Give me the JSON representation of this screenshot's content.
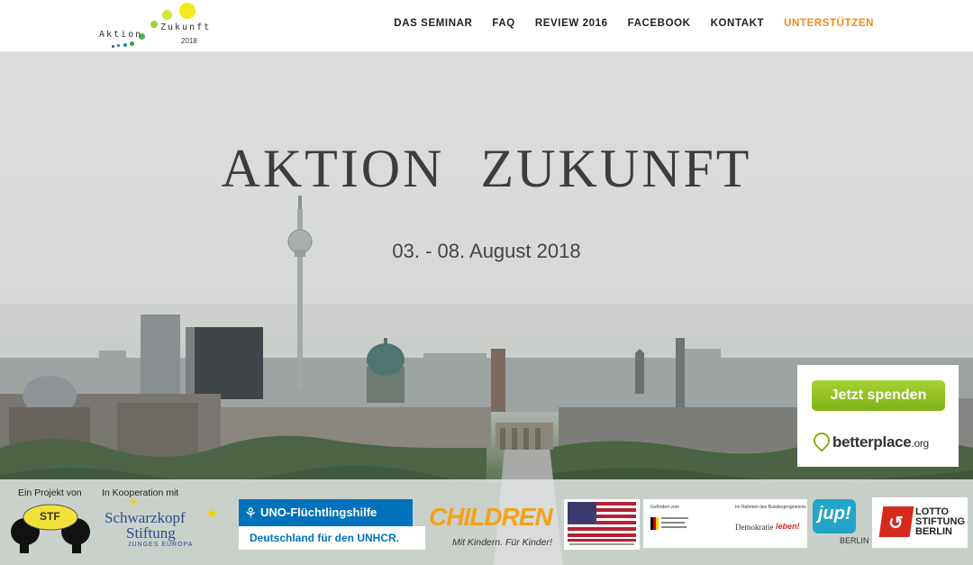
{
  "header": {
    "logo": {
      "word1": "Aktion",
      "word2": "Zukunft",
      "year": "2018"
    },
    "nav": [
      "DAS SEMINAR",
      "FAQ",
      "REVIEW 2016",
      "FACEBOOK",
      "KONTAKT",
      "UNTERSTÜTZEN"
    ],
    "accent_color": "#f08a17"
  },
  "hero": {
    "title": "AKTION ZUKUNFT",
    "date": "03. - 08. August 2018"
  },
  "donate": {
    "button_label": "Jetzt spenden",
    "brand": "betterplace",
    "brand_suffix": ".org",
    "button_color": "#8cc124"
  },
  "sponsors": {
    "label_project": "Ein Projekt von",
    "label_cooperation": "In Kooperation mit",
    "stf": "STF",
    "schwarzkopf_line1": "Schwarzkopf",
    "schwarzkopf_line2": "Stiftung",
    "schwarzkopf_line3": "JUNGES EUROPA",
    "unhcr_line1": "UNO-Flüchtlingshilfe",
    "unhcr_line2": "Deutschland für den UNHCR.",
    "children": "CHILDREN",
    "children_sub": "Mit Kindern. Für Kinder!",
    "bmfsfj_line1": "Gefördert vom",
    "bmfsfj_line2": "Im Rahmen des Bundesprogramms",
    "demokratie_a": "Demokratie",
    "demokratie_b": "leben!",
    "jup": "jup!",
    "jup_city": "BERLIN",
    "lotto_line1": "LOTTO",
    "lotto_line2": "STIFTUNG",
    "lotto_line3": "BERLIN"
  }
}
